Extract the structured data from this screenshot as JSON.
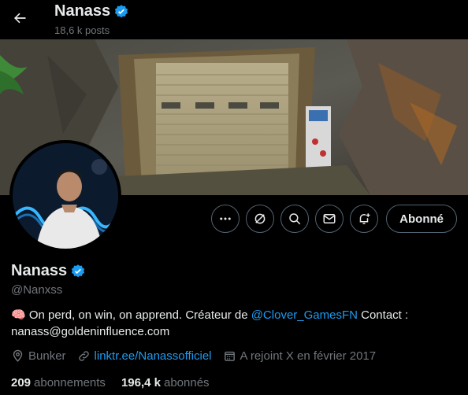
{
  "header": {
    "title": "Nanass",
    "posts_count": "18,6 k posts"
  },
  "actions": {
    "follow_label": "Abonné"
  },
  "profile": {
    "name": "Nanass",
    "handle": "@Nanxss",
    "bio_emoji": "🧠",
    "bio_text_1": "On perd, on win, on apprend. Créateur de ",
    "bio_mention": "@Clover_GamesFN",
    "bio_text_2": " Contact : nanass@goldeninfluence.com",
    "location": "Bunker",
    "link": "linktr.ee/Nanassofficiel",
    "joined": "A rejoint X en février 2017",
    "following_count": "209",
    "following_label": "abonnements",
    "followers_count": "196,4 k",
    "followers_label": "abonnés"
  },
  "colors": {
    "accent": "#1d9bf0",
    "text": "#e7e9ea",
    "muted": "#71767b",
    "border": "#536471",
    "background": "#000000"
  },
  "icons": [
    "back-arrow-icon",
    "verified-badge-icon",
    "more-icon",
    "grok-icon",
    "search-icon",
    "message-icon",
    "notification-bell-icon",
    "location-icon",
    "link-icon",
    "calendar-icon"
  ]
}
